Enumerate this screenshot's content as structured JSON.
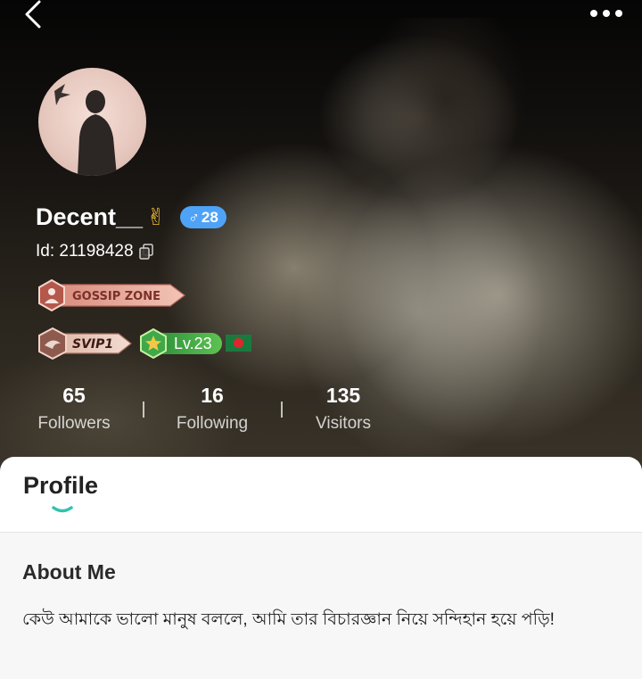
{
  "header": {
    "back_icon": "chevron-left-icon",
    "more_icon": "more-dots-icon"
  },
  "profile": {
    "username": "Decent__",
    "username_emoji": "✌",
    "gender_symbol": "♂",
    "age": "28",
    "id_text": "Id: 21198428",
    "badges": {
      "gossip": "GOSSIP ZONE",
      "svip": "SVIP1",
      "level": "Lv.23",
      "flag_icon": "bangladesh-flag-icon"
    }
  },
  "stats": [
    {
      "value": "65",
      "label": "Followers"
    },
    {
      "value": "16",
      "label": "Following"
    },
    {
      "value": "135",
      "label": "Visitors"
    }
  ],
  "tabs": {
    "profile_label": "Profile"
  },
  "about": {
    "title": "About Me",
    "text": "কেউ আমাকে ভালো মানুষ বললে, আমি তার বিচারজ্ঞান নিয়ে সন্দিহান হয়ে পড়ি!"
  },
  "colors": {
    "gender_badge": "#4fa3f7",
    "level_badge": "#3fa84a",
    "tab_indicator": "#2ec4b0",
    "gossip_badge": "#e8a79a"
  }
}
